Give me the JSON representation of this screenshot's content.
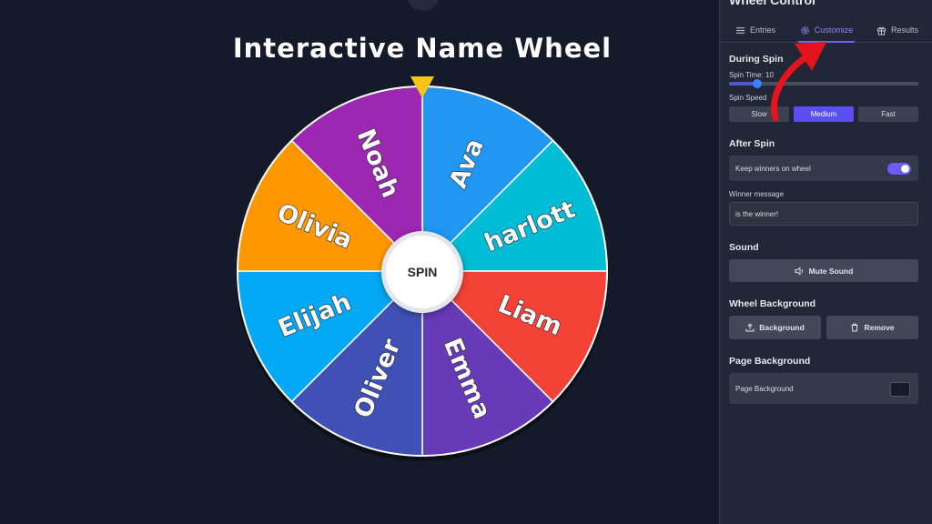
{
  "wheel": {
    "title": "Interactive Name Wheel",
    "spin_label": "SPIN",
    "pointer_color": "#f5c518",
    "segments": [
      {
        "name": "Ava",
        "color": "#2196f3"
      },
      {
        "name": "harlott",
        "color": "#00bcd4"
      },
      {
        "name": "Liam",
        "color": "#f44336"
      },
      {
        "name": "Emma",
        "color": "#673ab7"
      },
      {
        "name": "Oliver",
        "color": "#3f51b5"
      },
      {
        "name": "Elijah",
        "color": "#03a9f4"
      },
      {
        "name": "Olivia",
        "color": "#ff9800"
      },
      {
        "name": "Noah",
        "color": "#9c27b0"
      }
    ]
  },
  "panel": {
    "title": "Wheel Control",
    "tabs": [
      {
        "label": "Entries",
        "icon": "list-icon"
      },
      {
        "label": "Customize",
        "icon": "gear-icon"
      },
      {
        "label": "Results",
        "icon": "gift-icon"
      }
    ],
    "during_spin": {
      "heading": "During Spin",
      "spin_time_label": "Spin Time: 10",
      "spin_time_fraction": 0.15,
      "spin_speed_label": "Spin Speed",
      "speeds": [
        "Slow",
        "Medium",
        "Fast"
      ],
      "selected_speed": "Medium"
    },
    "after_spin": {
      "heading": "After Spin",
      "keep_winners_label": "Keep winners on wheel",
      "keep_winners_on": true,
      "winner_message_label": "Winner message",
      "winner_message_value": "is the winner!"
    },
    "sound": {
      "heading": "Sound",
      "mute_label": "Mute Sound"
    },
    "wheel_background": {
      "heading": "Wheel Background",
      "background_label": "Background",
      "remove_label": "Remove"
    },
    "page_background": {
      "heading": "Page Background",
      "label": "Page Background",
      "color": "#151b28"
    }
  },
  "annotation": {
    "arrow_color": "#e3141c"
  }
}
